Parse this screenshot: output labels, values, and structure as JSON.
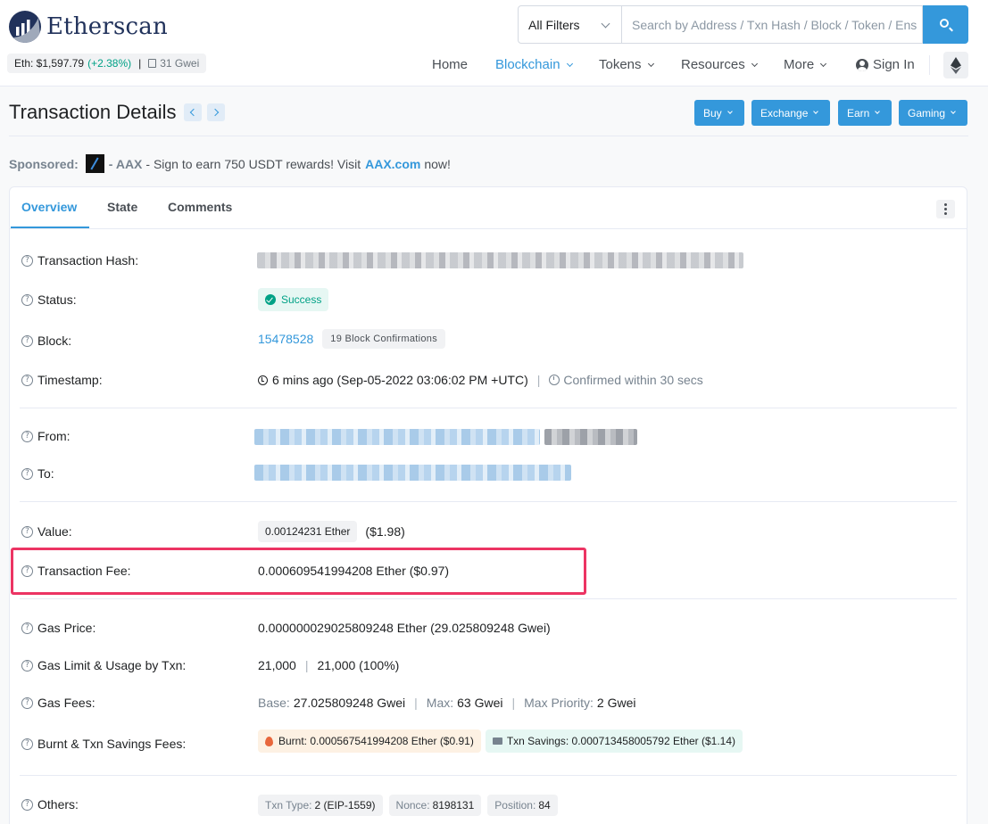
{
  "header": {
    "logo_text": "Etherscan",
    "eth_label": "Eth: $1,597.79",
    "eth_change": "(+2.38%)",
    "price_sep": "|",
    "gas": "31 Gwei",
    "search_filter": "All Filters",
    "search_placeholder": "Search by Address / Txn Hash / Block / Token / Ens"
  },
  "nav": {
    "home": "Home",
    "blockchain": "Blockchain",
    "tokens": "Tokens",
    "resources": "Resources",
    "more": "More",
    "sign_in": "Sign In"
  },
  "page": {
    "title": "Transaction Details",
    "actions": {
      "buy": "Buy",
      "exchange": "Exchange",
      "earn": "Earn",
      "gaming": "Gaming"
    }
  },
  "sponsored": {
    "label": "Sponsored:",
    "dash": "-",
    "brand": "AAX",
    "text": "- Sign to earn 750 USDT rewards! Visit",
    "link": "AAX.com",
    "tail": "now!"
  },
  "tabs": {
    "overview": "Overview",
    "state": "State",
    "comments": "Comments"
  },
  "details": {
    "q": "?",
    "labels": {
      "hash": "Transaction Hash:",
      "status": "Status:",
      "block": "Block:",
      "timestamp": "Timestamp:",
      "from": "From:",
      "to": "To:",
      "value": "Value:",
      "fee": "Transaction Fee:",
      "gas_price": "Gas Price:",
      "gas_limit": "Gas Limit & Usage by Txn:",
      "gas_fees": "Gas Fees:",
      "burnt": "Burnt & Txn Savings Fees:",
      "others": "Others:"
    },
    "status": "Success",
    "block": "15478528",
    "block_confirmations": "19 Block Confirmations",
    "timestamp": "6 mins ago (Sep-05-2022 03:06:02 PM +UTC)",
    "confirmed": "Confirmed within 30 secs",
    "value_badge": "0.00124231 Ether",
    "value_usd": "($1.98)",
    "fee": "0.000609541994208 Ether ($0.97)",
    "gas_price": "0.000000029025809248 Ether (29.025809248 Gwei)",
    "gas_limit": "21,000",
    "gas_usage": "21,000 (100%)",
    "gas_base_k": "Base:",
    "gas_base": "27.025809248 Gwei",
    "gas_max_k": "Max:",
    "gas_max": "63 Gwei",
    "gas_priority_k": "Max Priority:",
    "gas_priority": "2 Gwei",
    "burnt": "Burnt: 0.000567541994208 Ether ($0.91)",
    "savings": "Txn Savings: 0.000713458005792 Ether ($1.14)",
    "txn_type_k": "Txn Type:",
    "txn_type": "2 (EIP-1559)",
    "nonce_k": "Nonce:",
    "nonce": "8198131",
    "position_k": "Position:",
    "position": "84",
    "pipe": "|"
  },
  "colors": {
    "accent": "#3498db",
    "success": "#00a186",
    "highlight": "#ec3463"
  }
}
